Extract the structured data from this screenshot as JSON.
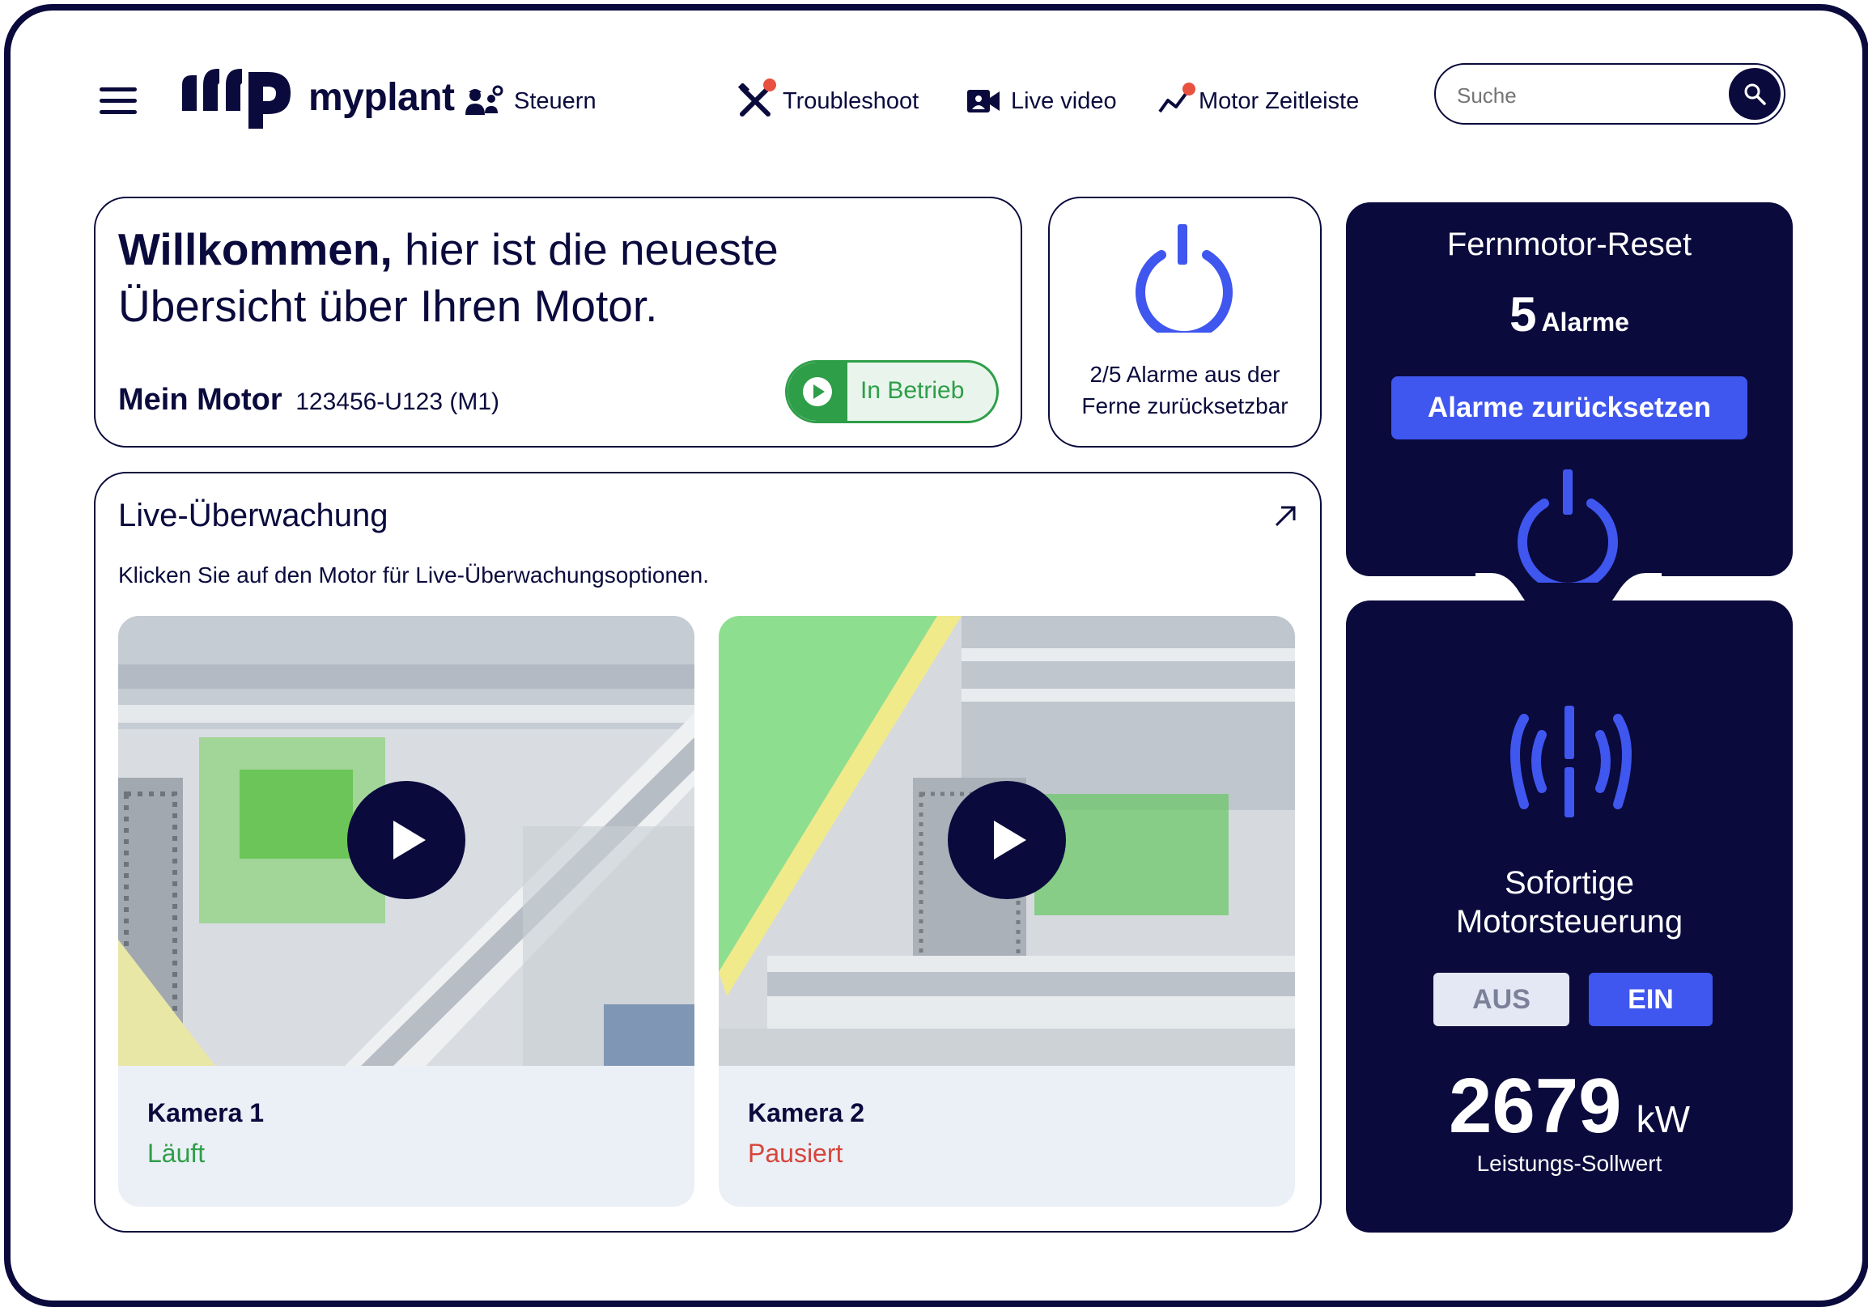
{
  "header": {
    "brand": "myplant",
    "nav": [
      {
        "label": "Steuern",
        "icon": "workers-gear-icon"
      },
      {
        "label": "Troubleshoot",
        "icon": "tools-icon"
      },
      {
        "label": "Live video",
        "icon": "video-camera-icon"
      },
      {
        "label": "Motor Zeitleiste",
        "icon": "timeline-chart-icon"
      }
    ],
    "search": {
      "placeholder": "Suche"
    }
  },
  "welcome": {
    "greeting_bold": "Willkommen,",
    "greeting_rest_line1": " hier ist die neueste",
    "greeting_line2": "Übersicht über Ihren Motor.",
    "motor_label": "Mein Motor",
    "motor_id": "123456-U123 (M1)",
    "status": "In Betrieb"
  },
  "alarms_card": {
    "line1": "2/5 Alarme aus der",
    "line2": "Ferne zurücksetzbar"
  },
  "live": {
    "title": "Live-Überwachung",
    "subtitle": "Klicken Sie auf den Motor für Live-Überwachungsoptionen.",
    "cameras": [
      {
        "name": "Kamera 1",
        "status": "Läuft",
        "status_color": "#2e9e48"
      },
      {
        "name": "Kamera 2",
        "status": "Pausiert",
        "status_color": "#d6453b"
      }
    ]
  },
  "reset": {
    "title": "Fernmotor-Reset",
    "count": "5",
    "count_label": "Alarme",
    "button": "Alarme zurücksetzen"
  },
  "control": {
    "title_line1": "Sofortige",
    "title_line2": "Motorsteuerung",
    "off_label": "AUS",
    "on_label": "EIN",
    "power_value": "2679",
    "power_unit": "kW",
    "power_label": "Leistungs-Sollwert"
  },
  "colors": {
    "navy": "#0a0a3d",
    "accent": "#3f56ef",
    "green": "#2e9e48",
    "red": "#d6453b"
  }
}
